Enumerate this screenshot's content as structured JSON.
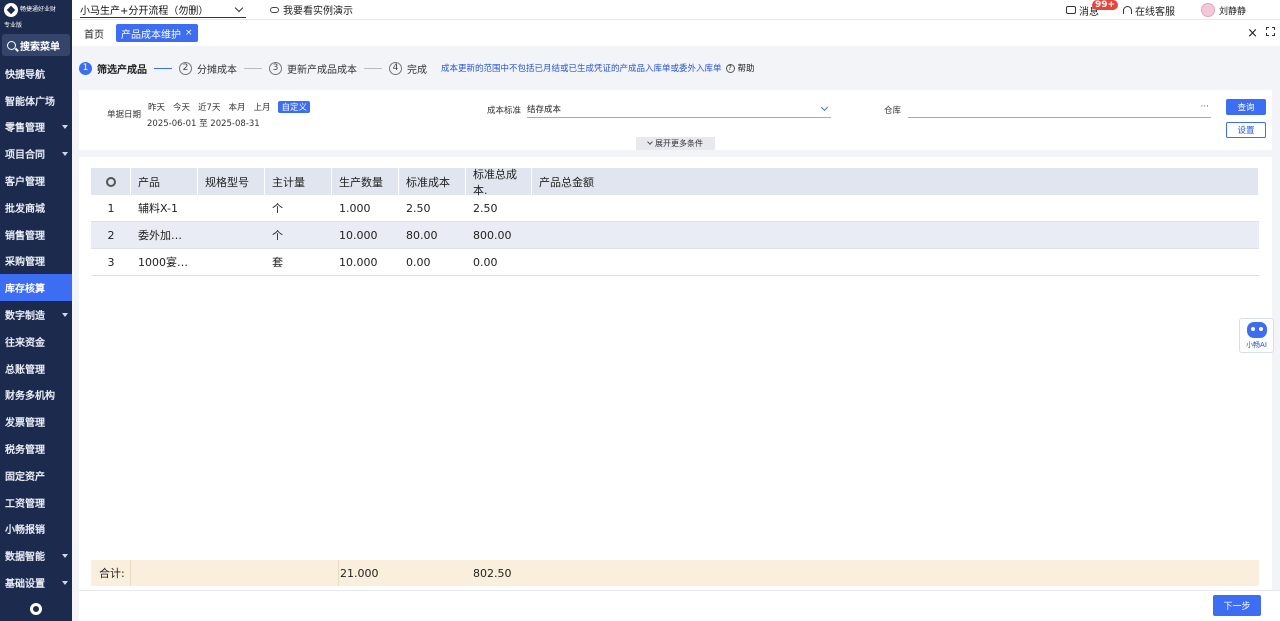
{
  "brand": {
    "name": "畅捷通好业财",
    "edition": "专业版"
  },
  "sidebar": {
    "search_label": "搜索菜单",
    "items": [
      {
        "label": "快捷导航",
        "has_submenu": false
      },
      {
        "label": "智能体广场",
        "has_submenu": false
      },
      {
        "label": "零售管理",
        "has_submenu": true
      },
      {
        "label": "项目合同",
        "has_submenu": true
      },
      {
        "label": "客户管理",
        "has_submenu": false
      },
      {
        "label": "批发商城",
        "has_submenu": false
      },
      {
        "label": "销售管理",
        "has_submenu": false
      },
      {
        "label": "采购管理",
        "has_submenu": false
      },
      {
        "label": "库存核算",
        "has_submenu": false,
        "active": true
      },
      {
        "label": "数字制造",
        "has_submenu": true
      },
      {
        "label": "往来资金",
        "has_submenu": false
      },
      {
        "label": "总账管理",
        "has_submenu": false
      },
      {
        "label": "财务多机构",
        "has_submenu": false
      },
      {
        "label": "发票管理",
        "has_submenu": false
      },
      {
        "label": "税务管理",
        "has_submenu": false
      },
      {
        "label": "固定资产",
        "has_submenu": false
      },
      {
        "label": "工资管理",
        "has_submenu": false
      },
      {
        "label": "小畅报销",
        "has_submenu": false
      },
      {
        "label": "数据智能",
        "has_submenu": true
      },
      {
        "label": "基础设置",
        "has_submenu": true
      }
    ]
  },
  "topbar": {
    "account": "小马生产+分开流程（勿删）",
    "demo_link": "我要看实例演示",
    "messages_label": "消息",
    "messages_badge": "99+",
    "service_label": "在线客服",
    "user_name": "刘静静"
  },
  "tabs": {
    "home": "首页",
    "active": "产品成本维护",
    "active_close": "×",
    "close_all": "×"
  },
  "steps": {
    "items": [
      {
        "num": "1",
        "label": "筛选产成品"
      },
      {
        "num": "2",
        "label": "分摊成本"
      },
      {
        "num": "3",
        "label": "更新产成品成本"
      },
      {
        "num": "4",
        "label": "完成"
      }
    ],
    "note": "成本更新的范围中不包括已月结或已生成凭证的产成品入库单或委外入库单",
    "help_label": "帮助"
  },
  "filter": {
    "date_label": "单据日期",
    "quick_dates": [
      "昨天",
      "今天",
      "近7天",
      "本月",
      "上月",
      "自定义"
    ],
    "date_range": "2025-06-01 至 2025-08-31",
    "cost_standard_label": "成本标准",
    "cost_standard_value": "结存成本",
    "warehouse_label": "仓库",
    "warehouse_value": "",
    "query_button": "查询",
    "settings_button": "设置",
    "expand_label": "展开更多条件"
  },
  "table": {
    "columns": [
      "产品",
      "规格型号",
      "主计量",
      "生产数量",
      "标准成本",
      "标准总成本.",
      "产品总金额"
    ],
    "rows": [
      {
        "idx": "1",
        "product": "辅料X-1",
        "spec": "",
        "unit": "个",
        "qty": "1.000",
        "std_cost": "2.50",
        "std_total": "2.50",
        "amount": ""
      },
      {
        "idx": "2",
        "product": "委外加…",
        "spec": "",
        "unit": "个",
        "qty": "10.000",
        "std_cost": "80.00",
        "std_total": "800.00",
        "amount": ""
      },
      {
        "idx": "3",
        "product": "1000宴…",
        "spec": "",
        "unit": "套",
        "qty": "10.000",
        "std_cost": "0.00",
        "std_total": "0.00",
        "amount": ""
      }
    ],
    "total_label": "合计:",
    "total_qty": "21.000",
    "total_std": "802.50"
  },
  "footer": {
    "next_button": "下一步"
  },
  "assistant": {
    "label": "小畅AI"
  }
}
